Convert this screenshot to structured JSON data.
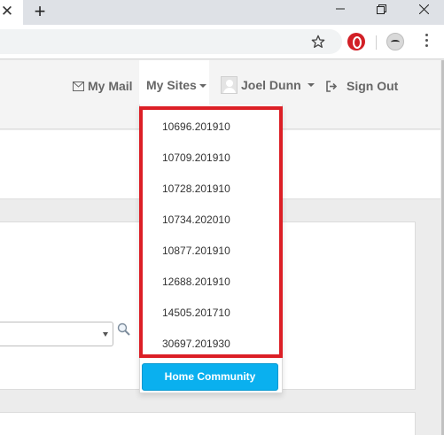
{
  "browser": {
    "tab_close_glyph": "✕",
    "new_tab_glyph": "+",
    "icons": [
      "minimize-icon",
      "restore-icon",
      "close-window-icon",
      "bookmark-star-icon",
      "opera-extension-icon",
      "face-extension-icon",
      "menu-kebab-icon"
    ]
  },
  "nav": {
    "mail_label": "My Mail",
    "sites_label": "My Sites",
    "user_name": "Joel Dunn",
    "signout_label": "Sign Out"
  },
  "sites_menu": {
    "items": [
      "10696.201910",
      "10709.201910",
      "10728.201910",
      "10734.202010",
      "10877.201910",
      "12688.201910",
      "14505.201710",
      "30697.201930"
    ],
    "home_button_label": "Home Community"
  },
  "colors": {
    "highlight_border": "#dc1f26",
    "home_button": "#0ab0ef",
    "opera_red": "#d21f26"
  }
}
